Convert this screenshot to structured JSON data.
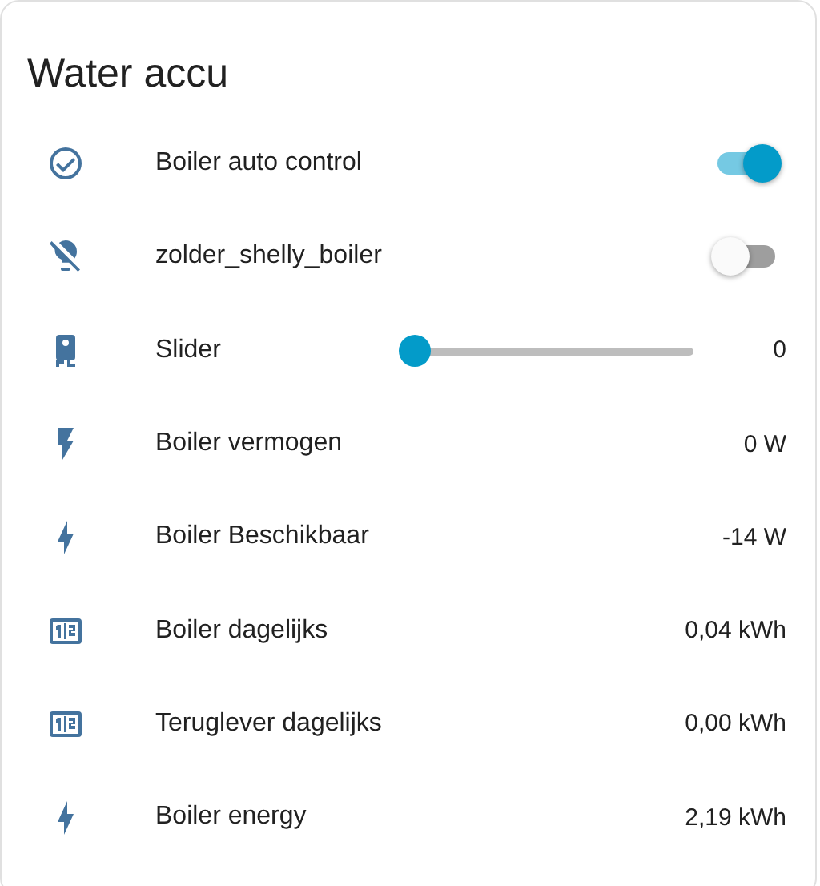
{
  "card": {
    "title": "Water accu",
    "rows": [
      {
        "kind": "toggle",
        "name": "Boiler auto control",
        "on": true
      },
      {
        "kind": "toggle",
        "name": "zolder_shelly_boiler",
        "on": false
      },
      {
        "kind": "slider",
        "name": "Slider",
        "level": 0,
        "reading": "0"
      },
      {
        "kind": "value",
        "name": "Boiler vermogen",
        "value": "0 W"
      },
      {
        "kind": "value",
        "name": "Boiler Beschikbaar",
        "value": "-14 W"
      },
      {
        "kind": "value",
        "name": "Boiler dagelijks",
        "value": "0,04 kWh"
      },
      {
        "kind": "value",
        "name": "Teruglever dagelijks",
        "value": "0,00 kWh"
      },
      {
        "kind": "value",
        "name": "Boiler energy",
        "value": "2,19 kWh"
      }
    ]
  }
}
